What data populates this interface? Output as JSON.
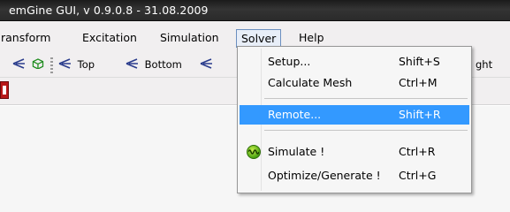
{
  "window": {
    "title": "emGine GUI, v 0.9.0.8 - 31.08.2009"
  },
  "menubar": {
    "items": [
      {
        "label": "ransform"
      },
      {
        "label": "Excitation"
      },
      {
        "label": "Simulation"
      },
      {
        "label": "Solver"
      },
      {
        "label": "Help"
      }
    ],
    "open_item": "Solver"
  },
  "toolbar": {
    "views": [
      {
        "label": "Top",
        "icon": "view-arrow-icon"
      },
      {
        "label": "Bottom",
        "icon": "view-arrow-icon"
      },
      {
        "label": "ght",
        "icon": "view-arrow-icon"
      }
    ]
  },
  "solver_menu": {
    "items": [
      {
        "label": "Setup...",
        "shortcut": "Shift+S"
      },
      {
        "label": "Calculate Mesh",
        "shortcut": "Ctrl+M"
      },
      {
        "label": "Remote...",
        "shortcut": "Shift+R",
        "highlighted": true
      },
      {
        "label": "Simulate !",
        "shortcut": "Ctrl+R",
        "icon": "simulate-icon"
      },
      {
        "label": "Optimize/Generate !",
        "shortcut": "Ctrl+G"
      }
    ]
  },
  "colors": {
    "highlight": "#3399ff",
    "titlebar": "#2a2a2a",
    "menu_bg": "#f6f6f6"
  }
}
